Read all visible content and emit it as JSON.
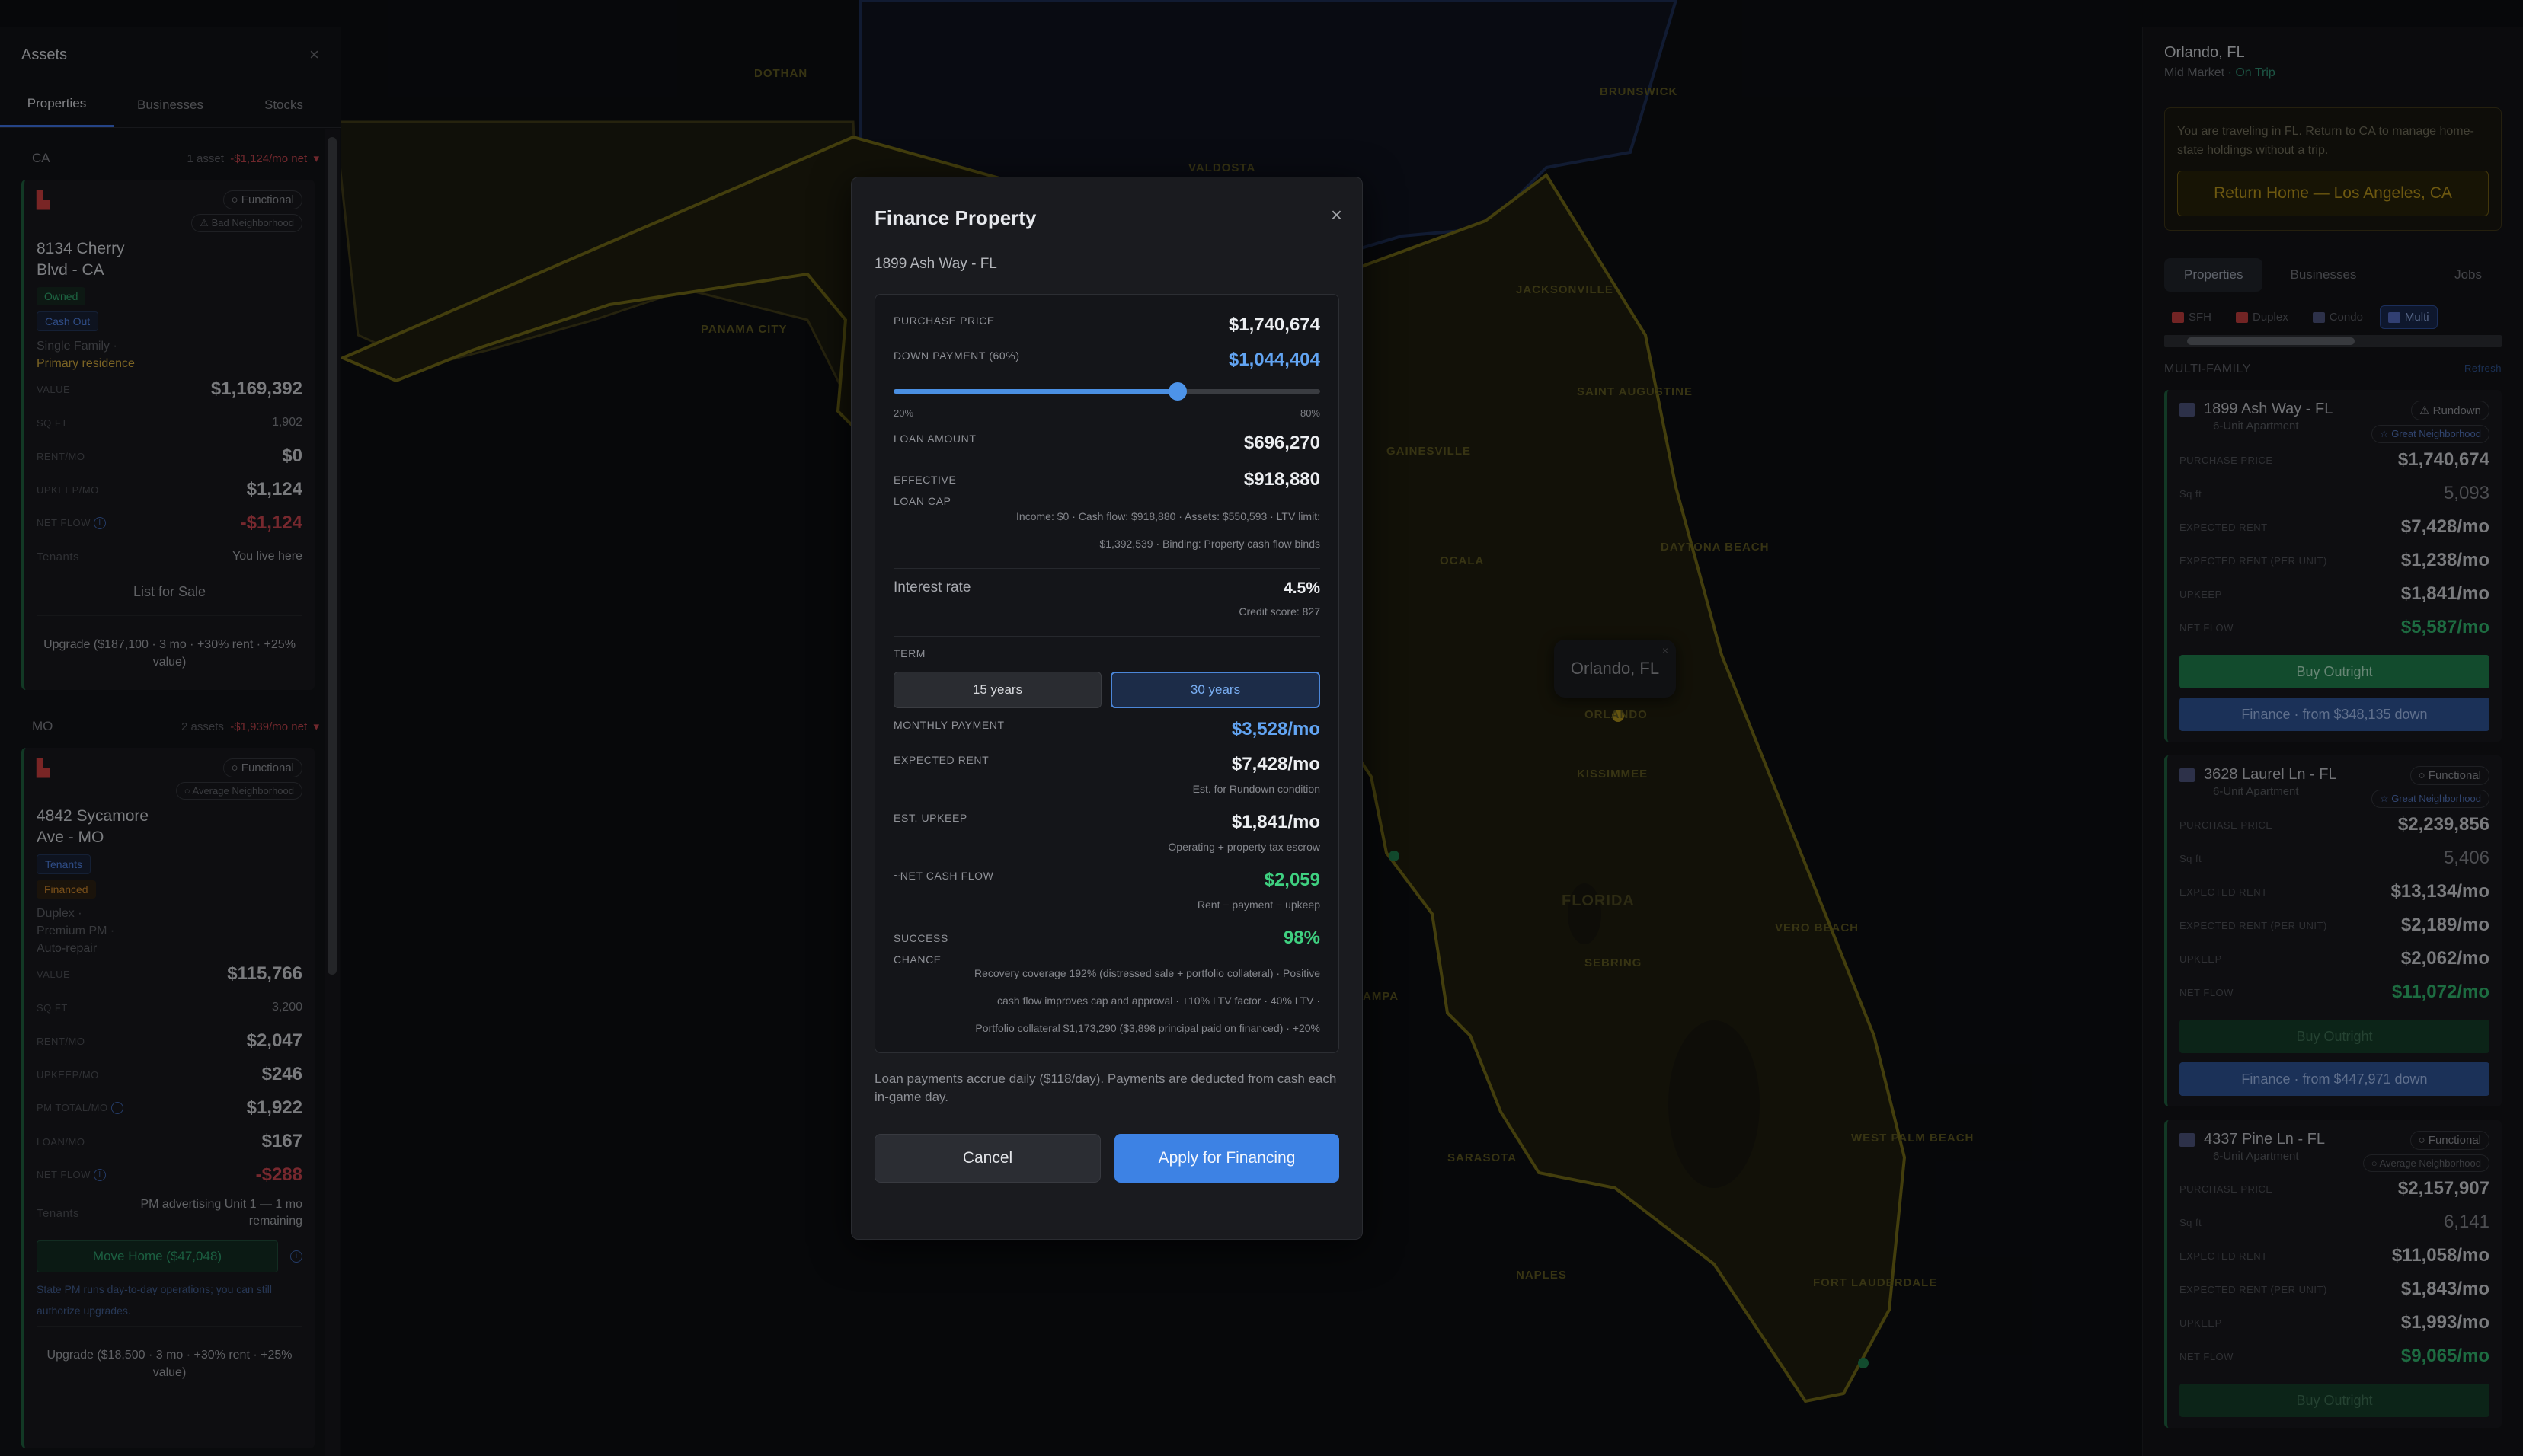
{
  "map": {
    "labels": [
      "DOTHAN",
      "VALDOSTA",
      "BRUNSWICK",
      "JACKSONVILLE",
      "SAINT AUGUSTINE",
      "GAINESVILLE",
      "OCALA",
      "DAYTONA BEACH",
      "ORLANDO",
      "KISSIMMEE",
      "FLORIDA",
      "VERO BEACH",
      "SEBRING",
      "NAPLES",
      "WEST PALM BEACH",
      "FORT LAUDERDALE",
      "PANAMA CITY",
      "TAMPA",
      "SARASOTA"
    ],
    "popup_city": "Orlando, FL",
    "popup_close": "×"
  },
  "assets": {
    "title": "Assets",
    "close": "×",
    "tabs": [
      "Properties",
      "Businesses",
      "Stocks"
    ],
    "groups": [
      {
        "state": "CA",
        "count": "1 asset",
        "net": "-$1,124/mo net",
        "chevron": "▾",
        "card": {
          "status": "Functional",
          "neighborhood": "Bad Neighborhood",
          "address": "8134 Cherry Blvd - CA",
          "tag1": "Owned",
          "tag2": "Cash Out",
          "type": "Single Family",
          "residence": "Primary residence",
          "rows": [
            {
              "k": "VALUE",
              "v": "$1,169,392"
            },
            {
              "k": "Sq ft",
              "v": "1,902"
            },
            {
              "k": "RENT/MO",
              "v": "$0"
            },
            {
              "k": "UPKEEP/MO",
              "v": "$1,124"
            },
            {
              "k": "NET FLOW",
              "v": "-$1,124"
            },
            {
              "k": "Tenants",
              "v": "You live here"
            }
          ],
          "list_btn": "List for Sale",
          "upgrade_btn": "Upgrade ($187,100 · 3 mo · +30% rent · +25% value)"
        }
      },
      {
        "state": "MO",
        "count": "2 assets",
        "net": "-$1,939/mo net",
        "chevron": "▾",
        "card": {
          "status": "Functional",
          "neighborhood": "Average Neighborhood",
          "address": "4842 Sycamore Ave - MO",
          "tag1": "Tenants",
          "tag2": "Financed",
          "type": "Duplex ·",
          "pm": "Premium PM ·",
          "repair": "Auto-repair",
          "rows": [
            {
              "k": "VALUE",
              "v": "$115,766"
            },
            {
              "k": "Sq ft",
              "v": "3,200"
            },
            {
              "k": "RENT/MO",
              "v": "$2,047"
            },
            {
              "k": "UPKEEP/MO",
              "v": "$246"
            },
            {
              "k": "PM TOTAL/MO",
              "v": "$1,922"
            },
            {
              "k": "LOAN/MO",
              "v": "$167"
            },
            {
              "k": "NET FLOW",
              "v": "-$288"
            },
            {
              "k": "Tenants",
              "v": "PM advertising Unit 1 — 1 mo remaining"
            }
          ],
          "move_btn": "Move Home ($47,048)",
          "state_note": "State PM runs day-to-day operations; you can still authorize upgrades.",
          "upgrade_btn": "Upgrade ($18,500 · 3 mo · +30% rent · +25% value)"
        }
      }
    ]
  },
  "right": {
    "city": "Orlando, FL",
    "market": "Mid Market",
    "trip": "· On Trip",
    "trip_msg": "You are traveling in FL. Return to CA to manage home-state holdings without a trip.",
    "return_btn": "Return Home — Los Angeles, CA",
    "tabs": [
      "Properties",
      "Businesses",
      "Jobs"
    ],
    "filters": [
      "SFH",
      "Duplex",
      "Condo",
      "Multi"
    ],
    "section": "MULTI-FAMILY",
    "refresh": "Refresh",
    "listings": [
      {
        "title": "1899 Ash Way - FL",
        "sub": "6-Unit Apartment",
        "status": "Rundown",
        "neighborhood": "Great Neighborhood",
        "rows": [
          {
            "k": "PURCHASE PRICE",
            "v": "$1,740,674"
          },
          {
            "k": "Sq ft",
            "v": "5,093"
          },
          {
            "k": "EXPECTED RENT",
            "v": "$7,428/mo"
          },
          {
            "k": "EXPECTED RENT (PER UNIT)",
            "v": "$1,238/mo"
          },
          {
            "k": "UPKEEP",
            "v": "$1,841/mo"
          },
          {
            "k": "NET FLOW",
            "v": "$5,587/mo"
          }
        ],
        "buy_btn": "Buy Outright",
        "finance_btn": "Finance · from $348,135 down"
      },
      {
        "title": "3628 Laurel Ln - FL",
        "sub": "6-Unit Apartment",
        "status": "Functional",
        "neighborhood": "Great Neighborhood",
        "rows": [
          {
            "k": "PURCHASE PRICE",
            "v": "$2,239,856"
          },
          {
            "k": "Sq ft",
            "v": "5,406"
          },
          {
            "k": "EXPECTED RENT",
            "v": "$13,134/mo"
          },
          {
            "k": "EXPECTED RENT (PER UNIT)",
            "v": "$2,189/mo"
          },
          {
            "k": "UPKEEP",
            "v": "$2,062/mo"
          },
          {
            "k": "NET FLOW",
            "v": "$11,072/mo"
          }
        ],
        "buy_btn": "Buy Outright",
        "finance_btn": "Finance · from $447,971 down"
      },
      {
        "title": "4337 Pine Ln - FL",
        "sub": "6-Unit Apartment",
        "status": "Functional",
        "neighborhood": "Average Neighborhood",
        "rows": [
          {
            "k": "PURCHASE PRICE",
            "v": "$2,157,907"
          },
          {
            "k": "Sq ft",
            "v": "6,141"
          },
          {
            "k": "EXPECTED RENT",
            "v": "$11,058/mo"
          },
          {
            "k": "EXPECTED RENT (PER UNIT)",
            "v": "$1,843/mo"
          },
          {
            "k": "UPKEEP",
            "v": "$1,993/mo"
          },
          {
            "k": "NET FLOW",
            "v": "$9,065/mo"
          }
        ],
        "buy_btn": "Buy Outright"
      }
    ]
  },
  "modal": {
    "title": "Finance Property",
    "close": "×",
    "property": "1899 Ash Way - FL",
    "purchase_label": "PURCHASE PRICE",
    "purchase_value": "$1,740,674",
    "down_label": "DOWN PAYMENT (60%)",
    "down_value": "$1,044,404",
    "slider_fraction": 0.6,
    "slider_min": "20%",
    "slider_max": "80%",
    "loan_label": "LOAN AMOUNT",
    "loan_value": "$696,270",
    "cap_label_1": "EFFECTIVE",
    "cap_label_2": "LOAN CAP",
    "cap_value": "$918,880",
    "cap_note": "Income: $0 · Cash flow: $918,880 · Assets: $550,593 · LTV limit: $1,392,539 · Binding: Property cash flow binds",
    "rate_label": "Interest rate",
    "rate_value": "4.5%",
    "credit_note": "Credit score: 827",
    "term_label": "TERM",
    "term_options": [
      "15 years",
      "30 years"
    ],
    "term_selected": "30 years",
    "monthly_label": "MONTHLY PAYMENT",
    "monthly_value": "$3,528/mo",
    "rent_label": "EXPECTED RENT",
    "rent_value": "$7,428/mo",
    "rent_note": "Est. for Rundown condition",
    "upkeep_label": "EST. UPKEEP",
    "upkeep_value": "$1,841/mo",
    "upkeep_note": "Operating + property tax escrow",
    "net_label": "~NET CASH FLOW",
    "net_value": "$2,059",
    "net_note": "Rent − payment − upkeep",
    "success_label_1": "SUCCESS",
    "success_label_2": "CHANCE",
    "success_value": "98%",
    "success_note": "Recovery coverage 192% (distressed sale + portfolio collateral) · Positive cash flow improves cap and approval · +10% LTV factor · 40% LTV · Portfolio collateral $1,173,290 ($3,898 principal paid on financed) · +20%",
    "footer": "Loan payments accrue daily ($118/day). Payments are deducted from cash each in-game day.",
    "cancel": "Cancel",
    "apply": "Apply for Financing"
  }
}
